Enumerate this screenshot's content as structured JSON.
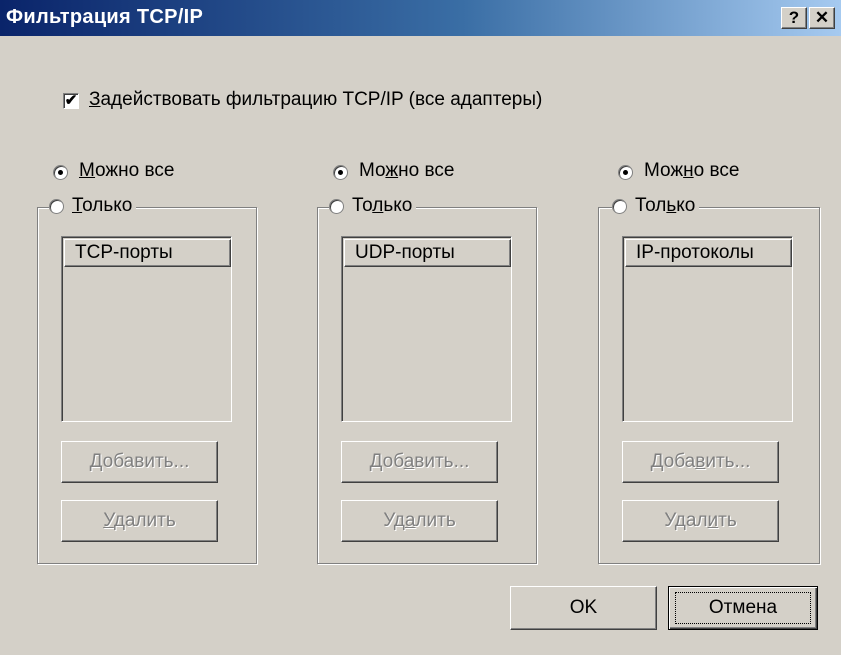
{
  "window": {
    "title": "Фильтрация TCP/IP",
    "help_label": "?",
    "close_label": "✕"
  },
  "enable_filter": {
    "checked": true,
    "label_before": "",
    "label_u": "З",
    "label_after": "адействовать фильтрацию TCP/IP (все адаптеры)"
  },
  "groups": [
    {
      "allow_all": {
        "before": "",
        "u": "М",
        "after": "ожно все",
        "selected": true
      },
      "only": {
        "before": "",
        "u": "Т",
        "after": "олько",
        "selected": false
      },
      "list_header": "TCP-порты",
      "add": {
        "before": "",
        "u": "Д",
        "after": "обавить..."
      },
      "remove": {
        "before": "",
        "u": "У",
        "after": "далить"
      }
    },
    {
      "allow_all": {
        "before": "Мо",
        "u": "ж",
        "after": "но все",
        "selected": true
      },
      "only": {
        "before": "То",
        "u": "л",
        "after": "ько",
        "selected": false
      },
      "list_header": "UDP-порты",
      "add": {
        "before": "Доб",
        "u": "а",
        "after": "вить..."
      },
      "remove": {
        "before": "Уд",
        "u": "а",
        "after": "лить"
      }
    },
    {
      "allow_all": {
        "before": "Мож",
        "u": "н",
        "after": "о все",
        "selected": true
      },
      "only": {
        "before": "Тол",
        "u": "ь",
        "after": "ко",
        "selected": false
      },
      "list_header": "IP-протоколы",
      "add": {
        "before": "Доба",
        "u": "в",
        "after": "ить..."
      },
      "remove": {
        "before": "Удал",
        "u": "и",
        "after": "ть"
      }
    }
  ],
  "footer": {
    "ok_label": "OK",
    "cancel_label": "Отмена"
  }
}
